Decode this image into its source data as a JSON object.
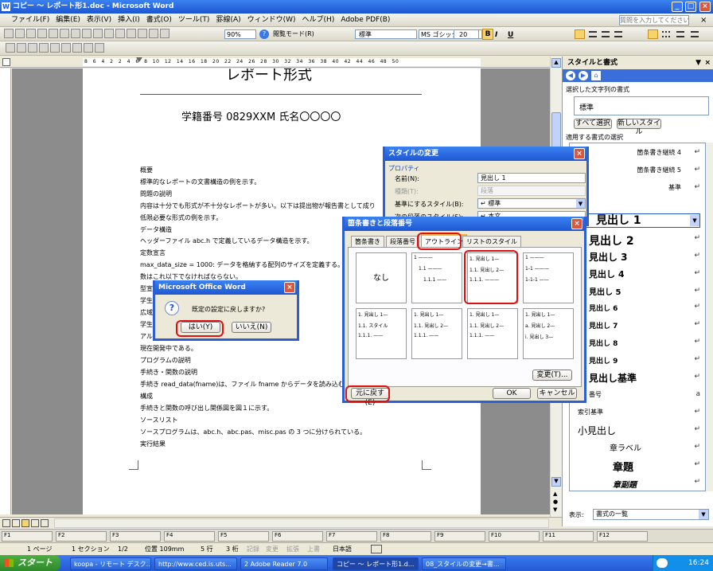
{
  "window": {
    "title": "コピー ～ レポート形1.doc - Microsoft Word"
  },
  "menubar": {
    "items": [
      "ファイル(F)",
      "編集(E)",
      "表示(V)",
      "挿入(I)",
      "書式(O)",
      "ツール(T)",
      "罫線(A)",
      "ウィンドウ(W)",
      "ヘルプ(H)",
      "Adobe PDF(B)"
    ],
    "help_placeholder": "質問を入力してください"
  },
  "toolbar": {
    "zoom": "90%",
    "reading_mode": "閲覧モード(R)",
    "style": "標準",
    "font": "MS ゴシック",
    "size": "20"
  },
  "ruler": {
    "numbers": "8 6 4 2 2 4 6 8 10 12 14 16 18 20 22 24 26 28 30 32 34 36 38 40 42 44 46 48 50"
  },
  "document": {
    "title": "レポート形式",
    "student_line": "学籍番号 0829XXM 氏名〇〇〇〇",
    "lines": [
      "概要",
      "標準的なレポートの文書構造の例を示す。",
      "問題の説明",
      "内容は十分でも形式が不十分なレポートが多い。以下は提出物が報告書として成り",
      "低限必要な形式の例を示す。",
      "データ構造",
      "ヘッダーファイル abc.h で定義しているデータ構造を示す。",
      "定数宣言",
      "max_data_size = 1000: データを格納する配列のサイズを定義する。",
      "数はこれ以下でなければならない。",
      "型宣言",
      "学生",
      "広域",
      "学生                                                    student",
      "アル",
      "現在開発中である。",
      "プログラムの説明",
      "手続き・関数の説明",
      "手続き read_data(fname)は、ファイル fname からデータを読み込む",
      "構成",
      "手続きと関数の呼び出し関係図を図１に示す。",
      "ソースリスト",
      "ソースプログラムは、abc.h、abc.pas、misc.pas の 3 つに分けられている。",
      "実行結果"
    ]
  },
  "style_change": {
    "title": "スタイルの変更",
    "property_label": "プロパティ",
    "name_label": "名前(N):",
    "name_value": "見出し 1",
    "type_label": "種類(T):",
    "type_value": "段落",
    "base_label": "基準にするスタイル(B):",
    "base_value": "↵ 標準",
    "next_label": "次の段落のスタイル(S):",
    "next_value": "↵ 本文"
  },
  "bullets_dialog": {
    "title": "箇条書きと段落番号",
    "tabs": [
      "箇条書き",
      "段落番号",
      "アウトライン",
      "リストのスタイル"
    ],
    "none_label": "なし",
    "thumbs": [
      [
        "1 ———",
        "1.1 ———",
        "1.1.1 ——"
      ],
      [
        "1. 見出し 1—",
        "1.1. 見出し 2—",
        "1.1.1. ———"
      ],
      [
        "1 ———",
        "1-1 ———",
        "1-1-1 ——"
      ],
      [
        "1. 見出し 1—",
        "1.1. スタイル",
        "1.1.1. ——"
      ],
      [
        "1. 見出し 1—",
        "1.1. 見出し 2—",
        "1.1.1. ——"
      ],
      [
        "1. 見出し 1—",
        "1.1. 見出し 2—",
        "1.1.1. ——"
      ],
      [
        "1. 見出し 1—",
        "a. 見出し 2—",
        "i. 見出し 3—"
      ]
    ],
    "modify_button": "変更(T)...",
    "reset_button": "元に戻す(E)",
    "ok_button": "OK",
    "cancel_button": "キャンセル"
  },
  "msgbox": {
    "title": "Microsoft Office Word",
    "message": "既定の設定に戻しますか?",
    "yes": "はい(Y)",
    "no": "いいえ(N)"
  },
  "task_pane": {
    "title": "スタイルと書式",
    "selected_label": "選択した文字列の書式",
    "selected_value": "標準",
    "select_all": "すべて選択",
    "new_style": "新しいスタイル",
    "apply_label": "適用する書式の選択",
    "styles": [
      "箇条書き継続 4",
      "箇条書き継続 5",
      "基準",
      "見出し 1",
      "見出し 2",
      "見出し 3",
      "見出し 4",
      "見出し 5",
      "見出し 6",
      "見出し 7",
      "見出し 8",
      "見出し 9",
      "見出し基準",
      "番号",
      "索引基準",
      "小見出し",
      "章ラベル",
      "章題",
      "章副題"
    ],
    "show_label": "表示:",
    "show_value": "書式の一覧"
  },
  "statusbar": {
    "page": "1 ページ",
    "section": "1 セクション",
    "pages": "1/2",
    "position": "位置 109mm",
    "line": "5 行",
    "column": "3 桁",
    "rec": "記録",
    "trk": "変更",
    "ext": "拡張",
    "ovr": "上書",
    "lang": "日本語"
  },
  "taskbar": {
    "start": "スタート",
    "items": [
      "koopa - リモート デスク...",
      "http://www.ced.is.uts...",
      "2 Adobe Reader 7.0",
      "コピー ～ レポート形1.d...",
      "08_スタイルの変更→書..."
    ],
    "time": "16:24"
  }
}
